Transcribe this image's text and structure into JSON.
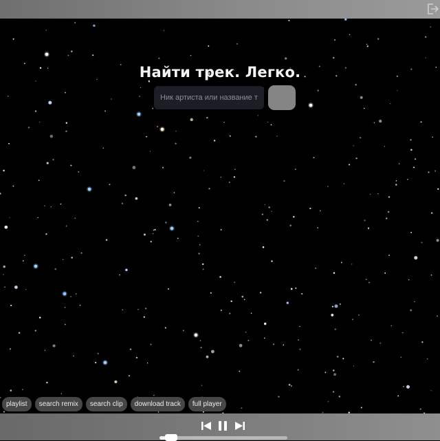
{
  "header": {
    "logout_icon": "logout-icon"
  },
  "hero": {
    "title": "Найти трек. Легко."
  },
  "search": {
    "placeholder": "Ник артиста или название трека",
    "value": "",
    "button_icon": "none"
  },
  "actions": [
    {
      "label": "playlist"
    },
    {
      "label": "search remix"
    },
    {
      "label": "search clip"
    },
    {
      "label": "download track"
    },
    {
      "label": "full player"
    }
  ],
  "player": {
    "controls": [
      "previous-track-icon",
      "pause-icon",
      "next-track-icon"
    ],
    "progress_fraction": 0.05
  },
  "colors": {
    "background": "#000000",
    "topbar": "#8a8a8a",
    "pill": "#474747",
    "search_field": "#1b1f25",
    "search_button": "#858585"
  }
}
